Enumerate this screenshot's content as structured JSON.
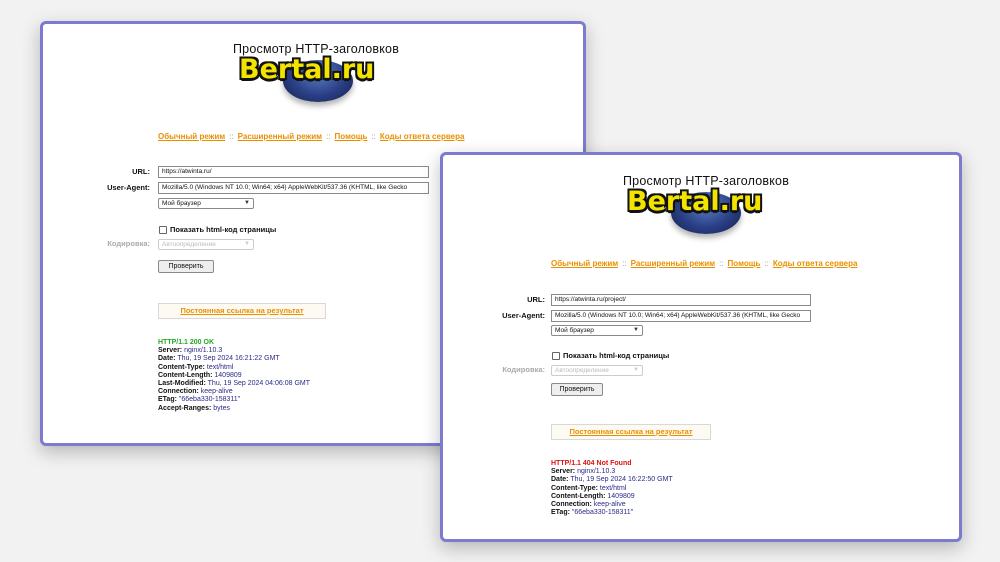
{
  "panel1": {
    "logo_title": "Просмотр HTTP-заголовков",
    "logo_text": "Bertal.ru",
    "nav": [
      "Обычный режим",
      "Расширенный режим",
      "Помощь",
      "Коды ответа сервера"
    ],
    "nav_sep": "::",
    "url_label": "URL:",
    "url_value": "https://atwinta.ru/",
    "ua_label": "User-Agent:",
    "ua_value": "Mozilla/5.0 (Windows NT 10.0; Win64; x64) AppleWebKit/537.36 (KHTML, like Gecko",
    "browser_select": "Мой браузер",
    "show_html_label": "Показать html-код страницы",
    "encoding_label": "Кодировка:",
    "encoding_value": "Автоопределение",
    "check_button": "Проверить",
    "permalink": "Постоянная ссылка на результат",
    "status": "HTTP/1.1 200 OK",
    "headers": [
      {
        "k": "Server:",
        "v": "nginx/1.10.3"
      },
      {
        "k": "Date:",
        "v": "Thu, 19 Sep 2024 16:21:22 GMT"
      },
      {
        "k": "Content-Type:",
        "v": "text/html"
      },
      {
        "k": "Content-Length:",
        "v": "1409809"
      },
      {
        "k": "Last-Modified:",
        "v": "Thu, 19 Sep 2024 04:06:08 GMT"
      },
      {
        "k": "Connection:",
        "v": "keep-alive"
      },
      {
        "k": "ETag:",
        "v": "\"66eba330-158311\""
      },
      {
        "k": "Accept-Ranges:",
        "v": "bytes"
      }
    ]
  },
  "panel2": {
    "logo_title": "Просмотр HTTP-заголовков",
    "logo_text": "Bertal.ru",
    "nav": [
      "Обычный режим",
      "Расширенный режим",
      "Помощь",
      "Коды ответа сервера"
    ],
    "nav_sep": "::",
    "url_label": "URL:",
    "url_value": "https://atwinta.ru/project/",
    "ua_label": "User-Agent:",
    "ua_value": "Mozilla/5.0 (Windows NT 10.0; Win64; x64) AppleWebKit/537.36 (KHTML, like Gecko",
    "browser_select": "Мой браузер",
    "show_html_label": "Показать html-код страницы",
    "encoding_label": "Кодировка:",
    "encoding_value": "Автоопределение",
    "check_button": "Проверить",
    "permalink": "Постоянная ссылка на результат",
    "status": "HTTP/1.1 404 Not Found",
    "headers": [
      {
        "k": "Server:",
        "v": "nginx/1.10.3"
      },
      {
        "k": "Date:",
        "v": "Thu, 19 Sep 2024 16:22:50 GMT"
      },
      {
        "k": "Content-Type:",
        "v": "text/html"
      },
      {
        "k": "Content-Length:",
        "v": "1409809"
      },
      {
        "k": "Connection:",
        "v": "keep-alive"
      },
      {
        "k": "ETag:",
        "v": "\"66eba330-158311\""
      }
    ]
  },
  "colors": {
    "panel_border": "#7b7bd0",
    "link": "#e89000",
    "status_ok": "#22aa22",
    "status_error": "#dd1111",
    "header_value": "#2a2a88",
    "logo_text": "#f3e400"
  }
}
